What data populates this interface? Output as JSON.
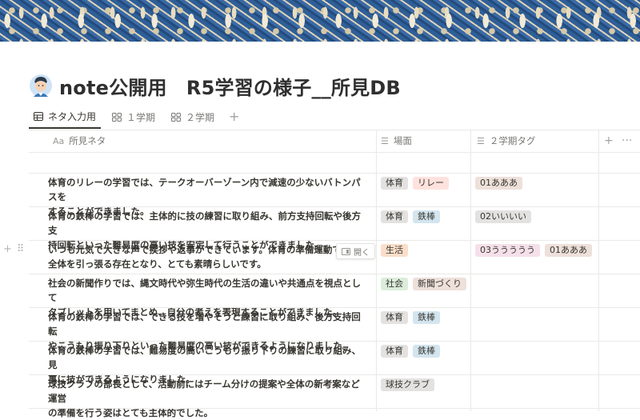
{
  "page": {
    "title": "note公開用　R5学習の様子__所見DB",
    "icon": "person-icon"
  },
  "views": [
    {
      "label": "ネタ入力用",
      "icon": "table-icon",
      "active": true
    },
    {
      "label": "１学期",
      "icon": "board-icon",
      "active": false
    },
    {
      "label": "２学期",
      "icon": "board-icon",
      "active": false
    }
  ],
  "add_view_label": "+",
  "columns": {
    "name": {
      "label": "所見ネタ",
      "icon": "Aa"
    },
    "scene": {
      "label": "場面",
      "icon": "multi-select-icon"
    },
    "term2": {
      "label": "２学期タグ",
      "icon": "multi-select-icon"
    },
    "add": "+",
    "more": "···"
  },
  "row_actions": {
    "add": "+",
    "drag": "⠿",
    "open_label": "開く"
  },
  "tag_colors": {
    "gray": "#e3e2e0",
    "brown": "#eee0da",
    "orange": "#fadec9",
    "pink": "#f5e0e9",
    "red": "#ffe2dd",
    "green": "#dbeddb",
    "blue": "#d3e5ef",
    "yellow": "#fdecc8"
  },
  "rows": [
    {
      "lines": [
        "",
        ""
      ],
      "scene": [],
      "term2": []
    },
    {
      "lines": [
        "体育のリレーの学習では、テークオーバーゾーン内で減速の少ないバトンパスを",
        "することができました。"
      ],
      "scene": [
        {
          "label": "体育",
          "color": "gray"
        },
        {
          "label": "リレー",
          "color": "red"
        }
      ],
      "term2": [
        {
          "label": "01あああ",
          "color": "brown"
        }
      ]
    },
    {
      "lines": [
        "体育の鉄棒の学習では、主体的に技の練習に取り組み、前方支持回転や後方支",
        "持回転といった難易度の高い技を安定して行うことができました。"
      ],
      "scene": [
        {
          "label": "体育",
          "color": "gray"
        },
        {
          "label": "鉄棒",
          "color": "blue"
        }
      ],
      "term2": [
        {
          "label": "02いいいい",
          "color": "gray"
        }
      ]
    },
    {
      "lines": [
        "いつも元気で大きな声で挨拶や返事ができています。体育の準備運動で",
        "全体を引っ張る存在となり、とても素晴らしいです。"
      ],
      "scene": [
        {
          "label": "生活",
          "color": "orange"
        }
      ],
      "term2": [
        {
          "label": "03ううううう",
          "color": "pink"
        },
        {
          "label": "01あああ",
          "color": "brown"
        }
      ],
      "hover": true
    },
    {
      "lines": [
        "社会の新聞作りでは、縄文時代や弥生時代の生活の違いや共通点を視点として",
        "タブレットを用いてまとめ、自分の考えを表現することができました。"
      ],
      "scene": [
        {
          "label": "社会",
          "color": "green"
        },
        {
          "label": "新聞づくり",
          "color": "brown"
        }
      ],
      "term2": []
    },
    {
      "lines": [
        "体育の鉄棒の学習では、できる技を増やそうと練習に取り組み、後方支持回転",
        "やこうもり振り下りといった難易度の高い技ができるようになりました。"
      ],
      "scene": [
        {
          "label": "体育",
          "color": "gray"
        },
        {
          "label": "鉄棒",
          "color": "blue"
        }
      ],
      "term2": []
    },
    {
      "lines": [
        "体育の鉄棒の学習では、難易度の高いこうもり振り下りの練習に取り組み、見",
        "事に技ができるようになりました。"
      ],
      "scene": [
        {
          "label": "体育",
          "color": "gray"
        },
        {
          "label": "鉄棒",
          "color": "blue"
        }
      ],
      "term2": []
    },
    {
      "lines": [
        "球技クラブの部長として、活動前にはチーム分けの提案や全体の新考案など運営",
        "の準備を行う姿はとても主体的でした。"
      ],
      "scene": [
        {
          "label": "球技クラブ",
          "color": "gray"
        }
      ],
      "term2": []
    }
  ]
}
